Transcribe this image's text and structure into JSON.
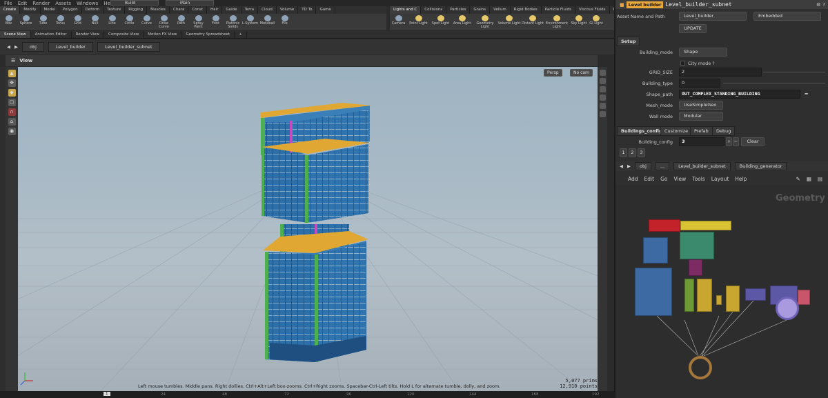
{
  "menubar": {
    "items": [
      "File",
      "Edit",
      "Render",
      "Assets",
      "Windows",
      "Help"
    ],
    "desktop": "Build",
    "desktop2": "Main"
  },
  "shelf_tabs": [
    "Create",
    "Modify",
    "Model",
    "Polygon",
    "Deform",
    "Texture",
    "Rigging",
    "Muscles",
    "Chara",
    "Const",
    "Hair",
    "Guide",
    "Terra",
    "Cloud",
    "Volume",
    "TD To",
    "Game"
  ],
  "shelf_tools": [
    "Box",
    "Sphere",
    "Tube",
    "Torus",
    "Grid",
    "Null",
    "Line",
    "Circle",
    "Curve",
    "Draw Curve",
    "Path",
    "Spray Paint",
    "Font",
    "Platonic Solids",
    "L-System",
    "Metaball",
    "File"
  ],
  "shelf_tabs2": [
    "Lights and C",
    "Collisions",
    "Particles",
    "Grains",
    "Vellum",
    "Rigid Bodies",
    "Particle Fluids",
    "Viscous Fluids",
    "Oceans"
  ],
  "shelf_tools2": [
    "Camera",
    "Point Light",
    "Spot Light",
    "Area Light",
    "Geometry Light",
    "Volume Light",
    "Distant Light",
    "Environment Light",
    "Sky Light",
    "GI Light"
  ],
  "pane_tabs": [
    "Scene View",
    "Animation Editor",
    "Render View",
    "Composite View",
    "Motion FX View",
    "Geometry Spreadsheet"
  ],
  "path": {
    "root": "obj",
    "level1": "Level_builder",
    "level2": "Level_builder_subnet"
  },
  "viewport": {
    "label": "View",
    "persp": "Persp",
    "cam": "No cam",
    "status": "Left mouse tumbles. Middle pans. Right dollies. Ctrl+Alt+Left box-zooms. Ctrl+Right zooms. Spacebar-Ctrl-Left tilts. Hold L for alternate tumble, dolly, and zoom.",
    "prims": "5,077  prims",
    "points": "12,910 points"
  },
  "timeline": {
    "frame": "1",
    "ticks": [
      "24",
      "48",
      "72",
      "96",
      "120",
      "144",
      "168",
      "192",
      "216"
    ]
  },
  "params": {
    "tab": "Level builder",
    "title": "Level_builder_subnet",
    "asset_label": "Asset Name and Path",
    "asset_value": "Level_builder",
    "embedded": "Embedded",
    "update": "UPDATE",
    "setup": "Setup",
    "building_mode_label": "Building_mode",
    "building_mode": "Shape",
    "city_mode": "City mode ?",
    "grid_size_label": "GRID_SIZE",
    "grid_size": "2",
    "building_type_label": "Building_type",
    "building_type": "0",
    "shape_path_label": "Shape_path",
    "shape_path": "OUT_COMPLEX_STANDING_BUILDING",
    "mesh_mode_label": "Mesh_mode",
    "mesh_mode": "UseSimpleGeo",
    "wall_mode_label": "Wall mode",
    "wall_mode": "Modular",
    "subtabs": [
      "Buildings_config",
      "Customize",
      "Prefab",
      "Debug"
    ],
    "bconfig_label": "Building_config",
    "bconfig_value": "3",
    "clear": "Clear",
    "multi": [
      "1",
      "2",
      "3"
    ]
  },
  "network": {
    "path": [
      "obj",
      "...",
      "Level_builder_subnet",
      "Building_generator"
    ],
    "menu": [
      "Add",
      "Edit",
      "Go",
      "View",
      "Tools",
      "Layout",
      "Help"
    ],
    "watermark": "Geometry"
  },
  "colors": {
    "accent": "#e8a73a",
    "facade": "#2d6fa8",
    "trim": "#d9a330",
    "green": "#4caf50"
  }
}
